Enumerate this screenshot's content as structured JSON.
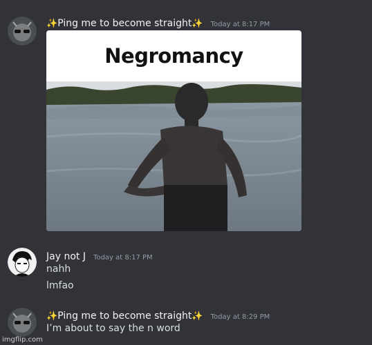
{
  "messages": [
    {
      "username_left": "✨",
      "username": "Ping me to become straight",
      "username_right": "✨",
      "timestamp": "Today at 8:17 PM",
      "embed": {
        "caption": "Negromancy"
      }
    },
    {
      "username": "Jay not J",
      "timestamp": "Today at 8:17 PM",
      "lines": [
        "nahh",
        "lmfao"
      ]
    },
    {
      "username_left": "✨",
      "username": "Ping me to become straight",
      "username_right": "✨",
      "timestamp": "Today at 8:29 PM",
      "lines": [
        "I’m about to say the n word"
      ]
    }
  ],
  "watermark": "imgflip.com"
}
